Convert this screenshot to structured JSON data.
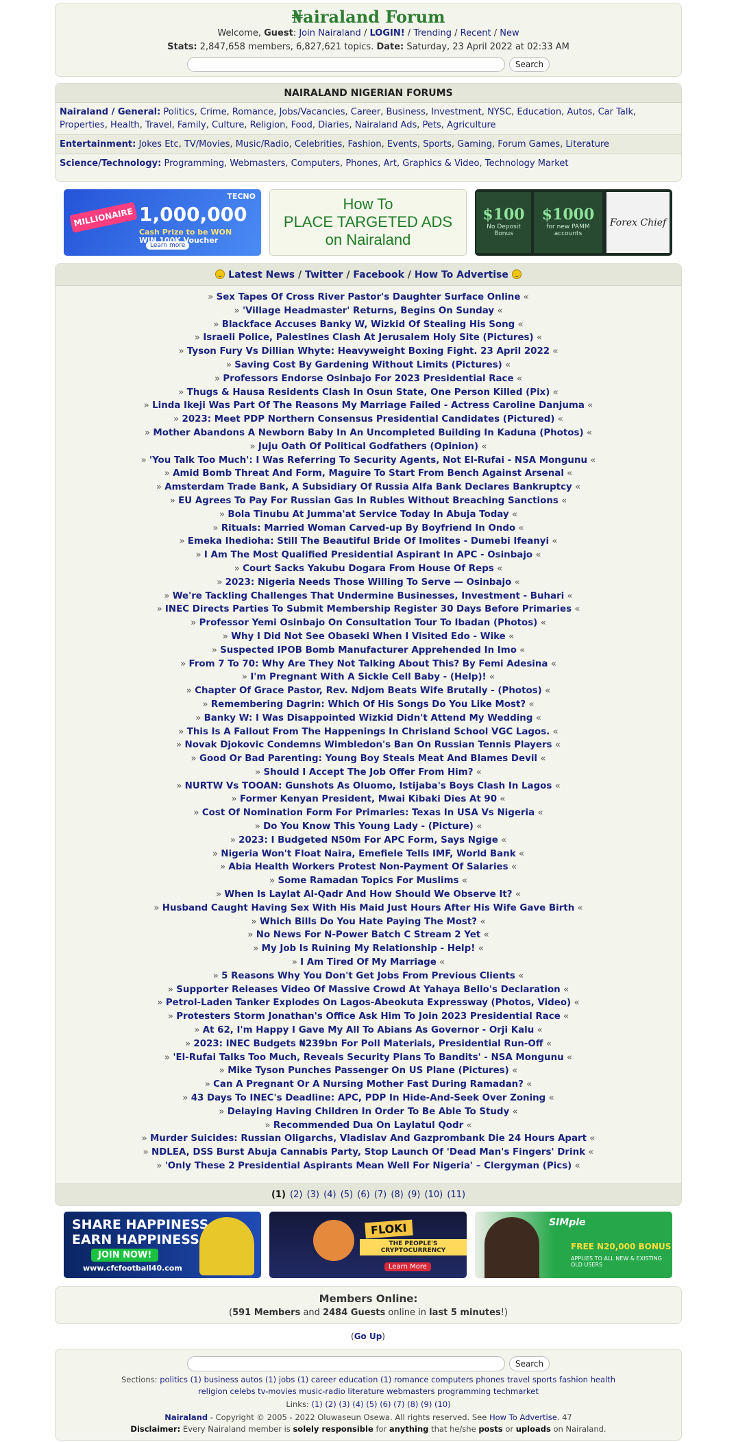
{
  "header": {
    "title": "₦airaland Forum",
    "welcome_prefix": "Welcome,",
    "guest": "Guest",
    "join": "Join Nairaland",
    "login": "LOGIN!",
    "trending": "Trending",
    "recent": "Recent",
    "new": "New",
    "stats_label": "Stats:",
    "stats_value": "2,847,658 members, 6,827,621 topics.",
    "date_label": "Date:",
    "date_value": "Saturday, 23 April 2022 at 02:33 AM",
    "search_button": "Search"
  },
  "forums": {
    "title": "NAIRALAND NIGERIAN FORUMS",
    "general_label": "Nairaland / General:",
    "general": [
      "Politics",
      "Crime",
      "Romance",
      "Jobs/Vacancies",
      "Career",
      "Business",
      "Investment",
      "NYSC",
      "Education",
      "Autos",
      "Car Talk",
      "Properties",
      "Health",
      "Travel",
      "Family",
      "Culture",
      "Religion",
      "Food",
      "Diaries",
      "Nairaland Ads",
      "Pets",
      "Agriculture"
    ],
    "entertainment_label": "Entertainment:",
    "entertainment": [
      "Jokes Etc",
      "TV/Movies",
      "Music/Radio",
      "Celebrities",
      "Fashion",
      "Events",
      "Sports",
      "Gaming",
      "Forum Games",
      "Literature"
    ],
    "science_label": "Science/Technology:",
    "science": [
      "Programming",
      "Webmasters",
      "Computers",
      "Phones",
      "Art, Graphics & Video",
      "Technology Market"
    ]
  },
  "ads_top": {
    "tecno": {
      "brand": "TECNO",
      "badge": "MILLIONAIRE",
      "amount": "1,000,000",
      "line1": "Cash Prize to be WON",
      "line2": "WIN 100K Voucher",
      "learn": "Learn more"
    },
    "target": {
      "line1": "How To",
      "line2": "PLACE TARGETED ADS",
      "line3": "on Nairaland"
    },
    "forex": {
      "a1": "$100",
      "a1_sub": "No Deposit Bonus",
      "a2": "$1000",
      "a2_sub": "for new PAMM accounts",
      "logo": "Forex Chief"
    }
  },
  "news": {
    "head_latest": "Latest News",
    "head_twitter": "Twitter",
    "head_facebook": "Facebook",
    "head_advertise": "How To Advertise",
    "items": [
      "Sex Tapes Of Cross River Pastor's Daughter Surface Online",
      "'Village Headmaster' Returns, Begins On Sunday",
      "Blackface Accuses Banky W, Wizkid Of Stealing His Song",
      "Israeli Police, Palestines Clash At Jerusalem Holy Site (Pictures)",
      "Tyson Fury Vs Dillian Whyte: Heavyweight Boxing Fight. 23 April 2022",
      "Saving Cost By Gardening Without Limits (Pictures)",
      "Professors Endorse Osinbajo For 2023 Presidential Race",
      "Thugs & Hausa Residents Clash In Osun State, One Person Killed (Pix)",
      "Linda Ikeji Was Part Of The Reasons My Marriage Failed - Actress Caroline Danjuma",
      "2023: Meet PDP Northern Consensus Presidential Candidates (Pictured)",
      "Mother Abandons A Newborn Baby In An Uncompleted Building In Kaduna (Photos)",
      "Juju Oath Of Political Godfathers (Opinion)",
      "'You Talk Too Much': I Was Referring To Security Agents, Not El-Rufai - NSA Mongunu",
      "Amid Bomb Threat And Form, Maguire To Start From Bench Against Arsenal",
      "Amsterdam Trade Bank, A Subsidiary Of Russia Alfa Bank Declares Bankruptcy",
      "EU Agrees To Pay For Russian Gas In Rubles Without Breaching Sanctions",
      "Bola Tinubu At Jumma'at Service Today In Abuja Today",
      "Rituals: Married Woman Carved-up By Boyfriend In Ondo",
      "Emeka Ihedioha: Still The Beautiful Bride Of Imolites - Dumebi Ifeanyi",
      "I Am The Most Qualified Presidential Aspirant In APC - Osinbajo",
      "Court Sacks Yakubu Dogara From House Of Reps",
      "2023: Nigeria Needs Those Willing To Serve — Osinbajo",
      "We're Tackling Challenges That Undermine Businesses, Investment - Buhari",
      "INEC Directs Parties To Submit Membership Register 30 Days Before Primaries",
      "Professor Yemi Osinbajo On Consultation Tour To Ibadan (Photos)",
      "Why I Did Not See Obaseki When I Visited Edo - Wike",
      "Suspected IPOB Bomb Manufacturer Apprehended In Imo",
      "From 7 To 70: Why Are They Not Talking About This? By Femi Adesina",
      "I'm Pregnant With A Sickle Cell Baby - (Help)!",
      "Chapter Of Grace Pastor, Rev. Ndjom Beats Wife Brutally - (Photos)",
      "Remembering Dagrin: Which Of His Songs Do You Like Most?",
      "Banky W: I Was Disappointed Wizkid Didn't Attend My Wedding",
      "This Is A Fallout From The Happenings In Chrisland School VGC Lagos.",
      "Novak Djokovic Condemns Wimbledon's Ban On Russian Tennis Players",
      "Good Or Bad Parenting: Young Boy Steals Meat And Blames Devil",
      "Should I Accept The Job Offer From Him?",
      "NURTW Vs TOOAN: Gunshots As Oluomo, Istijaba's Boys Clash In Lagos",
      "Former Kenyan President, Mwai Kibaki Dies At 90",
      "Cost Of Nomination Form For Primaries: Texas In USA Vs Nigeria",
      "Do You Know This Young Lady - (Picture)",
      "2023: I Budgeted N50m For APC Form, Says Ngige",
      "Nigeria Won't Float Naira, Emefiele Tells IMF, World Bank",
      "Abia Health Workers Protest Non-Payment Of Salaries",
      "Some Ramadan Topics For Muslims",
      "When Is Laylat Al-Qadr And How Should We Observe It?",
      "Husband Caught Having Sex With His Maid Just Hours After His Wife Gave Birth",
      "Which Bills Do You Hate Paying The Most?",
      "No News For N-Power Batch C Stream 2 Yet",
      "My Job Is Ruining My Relationship - Help!",
      "I Am Tired Of My Marriage",
      "5 Reasons Why You Don't Get Jobs From Previous Clients",
      "Supporter Releases Video Of Massive Crowd At Yahaya Bello's Declaration",
      "Petrol-Laden Tanker Explodes On Lagos-Abeokuta Expressway (Photos, Video)",
      "Protesters Storm Jonathan's Office Ask Him To Join 2023 Presidential Race",
      "At 62, I'm Happy I Gave My All To Abians As Governor - Orji Kalu",
      "2023: INEC Budgets ₦239bn For Poll Materials, Presidential Run-Off",
      "'El-Rufai Talks Too Much, Reveals Security Plans To Bandits' - NSA Mongunu",
      "Mike Tyson Punches Passenger On US Plane (Pictures)",
      "Can A Pregnant Or A Nursing Mother Fast During Ramadan?",
      "43 Days To INEC's Deadline: APC, PDP In Hide-And-Seek Over Zoning",
      "Delaying Having Children In Order To Be Able To Study",
      "Recommended Dua On Laylatul Qodr",
      "Murder Suicides: Russian Oligarchs, Vladislav And Gazprombank Die 24 Hours Apart",
      "NDLEA, DSS Burst Abuja Cannabis Party, Stop Launch Of 'Dead Man's Fingers' Drink",
      "'Only These 2 Presidential Aspirants Mean Well For Nigeria' – Clergyman (Pics)"
    ],
    "pages": [
      "(1)",
      "(2)",
      "(3)",
      "(4)",
      "(5)",
      "(6)",
      "(7)",
      "(8)",
      "(9)",
      "(10)",
      "(11)"
    ]
  },
  "ads_bottom": {
    "cfc": {
      "line1": "SHARE HAPPINESS",
      "line2": "EARN HAPPINESS",
      "join": "JOIN NOW!",
      "url": "www.cfcfootball40.com"
    },
    "floki": {
      "name": "FLOKI",
      "tag": "THE PEOPLE'S CRYPTOCURRENCY",
      "learn": "Learn More"
    },
    "mtn": {
      "brand": "SIMple",
      "bonus": "FREE N20,000 BONUS",
      "fine": "APPLIES TO ALL NEW & EXISTING OLD USERS"
    }
  },
  "members": {
    "title": "Members Online:",
    "members_count": "591 Members",
    "and": "and",
    "guests_count": "2484 Guests",
    "online_in": "online in",
    "period": "last 5 minutes"
  },
  "go_up": "Go Up",
  "footer": {
    "search_button": "Search",
    "sections_label": "Sections:",
    "sections": "politics (1) business autos (1) jobs (1) career education (1) romance computers phones travel sports fashion health",
    "sections2": "religion celebs tv-movies music-radio literature webmasters programming techmarket",
    "links_label": "Links:",
    "links": "(1) (2) (3) (4) (5) (6) (7) (8) (9) (10)",
    "copyright_brand": "Nairaland",
    "copyright": "- Copyright © 2005 - 2022 Oluwaseun Osewa. All rights reserved. See",
    "advertise": "How To Advertise",
    "copyright_num": ". 47",
    "disclaimer_label": "Disclaimer:",
    "disclaimer_a": "Every Nairaland member is",
    "disclaimer_b": "solely responsible",
    "disclaimer_c": "for",
    "disclaimer_d": "anything",
    "disclaimer_e": "that he/she",
    "disclaimer_f": "posts",
    "disclaimer_g": "or",
    "disclaimer_h": "uploads",
    "disclaimer_i": "on Nairaland."
  }
}
